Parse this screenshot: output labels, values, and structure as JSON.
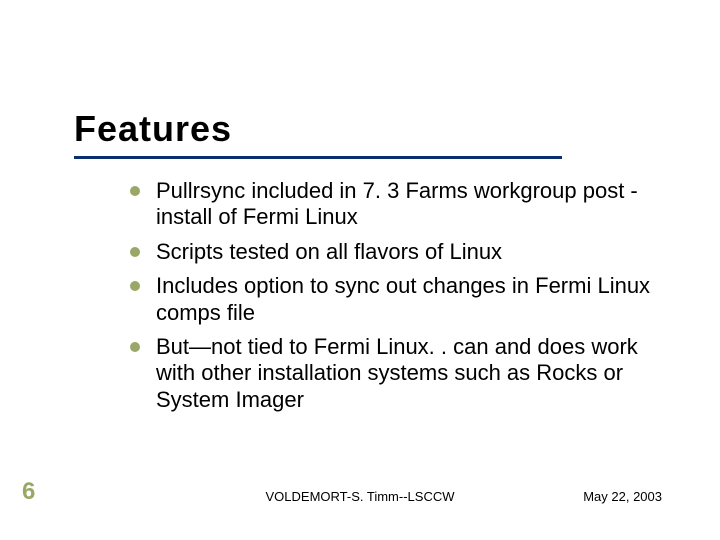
{
  "slide": {
    "title": "Features",
    "bullets": [
      "Pullrsync included in 7. 3 Farms workgroup post -install of Fermi Linux",
      "Scripts tested on all flavors of Linux",
      "Includes option to sync out changes in Fermi Linux comps file",
      "But—not tied to Fermi Linux. . can and does work with other installation systems such as Rocks or System Imager"
    ],
    "page_number": "6",
    "footer_center": "VOLDEMORT-S. Timm--LSCCW",
    "footer_date": "May 22, 2003"
  }
}
